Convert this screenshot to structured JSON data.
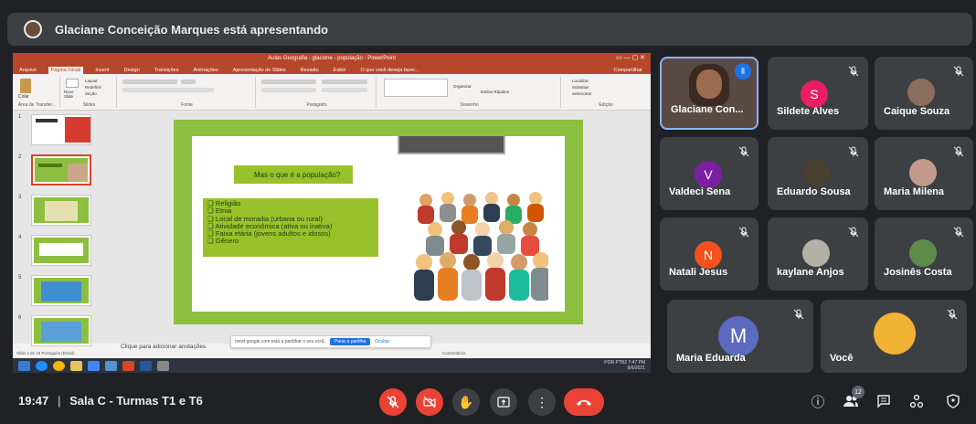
{
  "banner": {
    "text": "Glaciane Conceição Marques está apresentando"
  },
  "screen": {
    "window_title": "Aulas Geografia - glacione - população - PowerPoint",
    "ribbon_tabs": [
      "Arquivo",
      "Página Inicial",
      "Inserir",
      "Design",
      "Transições",
      "Animações",
      "Apresentação de Slides",
      "Revisão",
      "Exibir",
      "O que você deseja fazer..."
    ],
    "active_tab": "Página Inicial",
    "share_label": "Compartilhar",
    "ribbon_groups": [
      "Área de Transfer...",
      "Slides",
      "Fonte",
      "Parágrafo",
      "Desenho",
      "Edição"
    ],
    "ribbon_buttons": {
      "paste": "Colar",
      "new_slide": "Novo Slide",
      "layout": "Layout",
      "reset": "Redefinir",
      "section": "Seção",
      "find": "Localizar",
      "replace": "Substituir",
      "select": "Selecionar",
      "arrange": "Organizar",
      "quick_styles": "Estilos Rápidos"
    },
    "slide_numbers": [
      "1",
      "2",
      "3",
      "4",
      "5",
      "6"
    ],
    "slide": {
      "question": "Mas o que é a população?",
      "bullets": [
        "Religião",
        "Etnia",
        "Local de moradia (urbana ou rural)",
        "Atividade econômica (ativa ou inativa)",
        "Faixa etária (jovens adultos e idosos)",
        "Gênero"
      ]
    },
    "notes_placeholder": "Clique para adicionar anotações",
    "status_left": "Slide 2 de 18    Português (Brasil)",
    "status_right": "Comentários",
    "share_notice": "meet.google.com está a partilhar o seu ecrã.",
    "stop_share": "Parar a partilha",
    "hide": "Ocultar",
    "tray_lang": "POR PTB2",
    "tray_time": "7:47 PM",
    "tray_date": "9/6/2021"
  },
  "participants": [
    {
      "name": "Glaciane Con...",
      "kind": "video",
      "speaking": true
    },
    {
      "name": "Sildete Alves",
      "kind": "letter",
      "letter": "S",
      "color": "#e91e63"
    },
    {
      "name": "Caique Souza",
      "kind": "photo"
    },
    {
      "name": "Valdeci Sena",
      "kind": "letter",
      "letter": "V",
      "color": "#7b1fa2"
    },
    {
      "name": "Eduardo Sousa",
      "kind": "photo"
    },
    {
      "name": "Maria Milena",
      "kind": "photo"
    },
    {
      "name": "Natali Jesus",
      "kind": "letter",
      "letter": "N",
      "color": "#f4511e"
    },
    {
      "name": "kaylane Anjos",
      "kind": "photo"
    },
    {
      "name": "Josinês Costa",
      "kind": "photo"
    },
    {
      "name": "Maria Eduarda",
      "kind": "letter",
      "letter": "M",
      "color": "#5c6bc0"
    },
    {
      "name": "Você",
      "kind": "photo"
    }
  ],
  "bottom": {
    "time": "19:47",
    "separator": "|",
    "meeting": "Sala C - Turmas T1 e T6",
    "people_count": "12"
  },
  "colors": {
    "end_call": "#ea4335",
    "bg": "#202124",
    "tile": "#3c4043",
    "slide_green": "#8cbf3f"
  }
}
